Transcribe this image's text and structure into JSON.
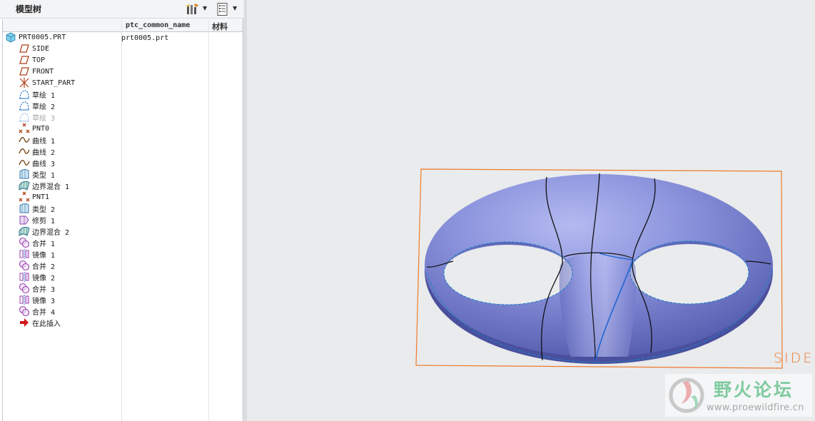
{
  "panel": {
    "title": "模型树",
    "toolbar": [
      "settings-icon",
      "show-icon"
    ]
  },
  "columns": {
    "name": "ptc_common_name",
    "material": "材料"
  },
  "tree": [
    {
      "label": "PRT0005.PRT",
      "icon": "part-icon",
      "dim": false
    },
    {
      "label": "SIDE",
      "icon": "datum-plane-icon",
      "dim": false
    },
    {
      "label": "TOP",
      "icon": "datum-plane-icon",
      "dim": false
    },
    {
      "label": "FRONT",
      "icon": "datum-plane-icon",
      "dim": false
    },
    {
      "label": "START_PART",
      "icon": "coordinate-system-icon",
      "dim": false
    },
    {
      "label": "草绘 1",
      "icon": "sketch-icon",
      "dim": false
    },
    {
      "label": "草绘 2",
      "icon": "sketch-icon",
      "dim": false
    },
    {
      "label": "草绘 3",
      "icon": "sketch-icon",
      "dim": true
    },
    {
      "label": "PNT0",
      "icon": "datum-point-icon",
      "dim": false
    },
    {
      "label": "曲线 1",
      "icon": "curve-icon",
      "dim": false
    },
    {
      "label": "曲线 2",
      "icon": "curve-icon",
      "dim": false
    },
    {
      "label": "曲线 3",
      "icon": "curve-icon",
      "dim": false
    },
    {
      "label": "类型 1",
      "icon": "surface-icon",
      "dim": false
    },
    {
      "label": "边界混合 1",
      "icon": "boundary-blend-icon",
      "dim": false
    },
    {
      "label": "PNT1",
      "icon": "datum-point-icon",
      "dim": false
    },
    {
      "label": "类型 2",
      "icon": "surface-icon",
      "dim": false
    },
    {
      "label": "修剪 1",
      "icon": "trim-icon",
      "dim": false
    },
    {
      "label": "边界混合 2",
      "icon": "boundary-blend-icon",
      "dim": false
    },
    {
      "label": "合并 1",
      "icon": "merge-icon",
      "dim": false
    },
    {
      "label": "镜像 1",
      "icon": "mirror-icon",
      "dim": false
    },
    {
      "label": "合并 2",
      "icon": "merge-icon",
      "dim": false
    },
    {
      "label": "镜像 2",
      "icon": "mirror-icon",
      "dim": false
    },
    {
      "label": "合并 3",
      "icon": "merge-icon",
      "dim": false
    },
    {
      "label": "镜像 3",
      "icon": "mirror-icon",
      "dim": false
    },
    {
      "label": "合并 4",
      "icon": "merge-icon",
      "dim": false
    },
    {
      "label": "在此插入",
      "icon": "insert-here-icon",
      "dim": false
    }
  ],
  "common_name_value": "prt0005.prt",
  "viewport": {
    "datum_label": "SIDE",
    "model_color": "#8a92dc",
    "datum_color": "#f07a2c"
  },
  "watermark": {
    "cn": "野火论坛",
    "url": "www.proewildfire.cn"
  }
}
